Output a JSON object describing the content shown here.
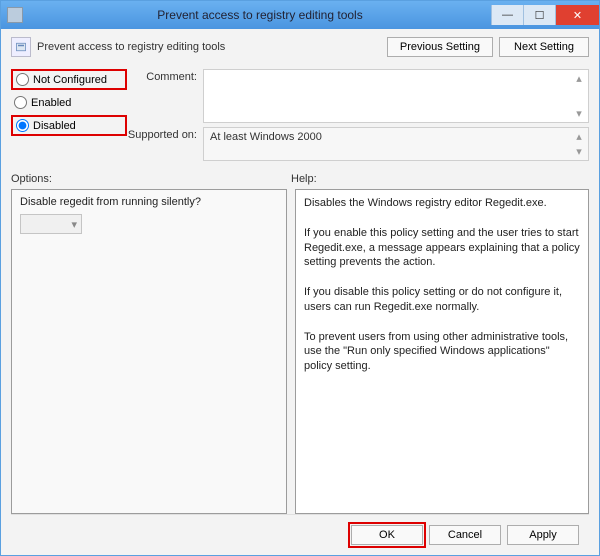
{
  "titlebar": {
    "title": "Prevent access to registry editing tools",
    "minimize": "—",
    "maximize": "☐",
    "close": "✕"
  },
  "header": {
    "subtitle": "Prevent access to registry editing tools",
    "prev_btn": "Previous Setting",
    "next_btn": "Next Setting"
  },
  "radios": {
    "not_configured": "Not Configured",
    "enabled": "Enabled",
    "disabled": "Disabled",
    "selected": "disabled"
  },
  "fields": {
    "comment_label": "Comment:",
    "comment_value": "",
    "supported_label": "Supported on:",
    "supported_value": "At least Windows 2000"
  },
  "sections": {
    "options_label": "Options:",
    "help_label": "Help:"
  },
  "options": {
    "question": "Disable regedit from running silently?",
    "dropdown_value": ""
  },
  "help": {
    "text": "Disables the Windows registry editor Regedit.exe.\n\nIf you enable this policy setting and the user tries to start Regedit.exe, a message appears explaining that a policy setting prevents the action.\n\nIf you disable this policy setting or do not configure it, users can run Regedit.exe normally.\n\nTo prevent users from using other administrative tools, use the \"Run only specified Windows applications\" policy setting."
  },
  "footer": {
    "ok": "OK",
    "cancel": "Cancel",
    "apply": "Apply"
  }
}
